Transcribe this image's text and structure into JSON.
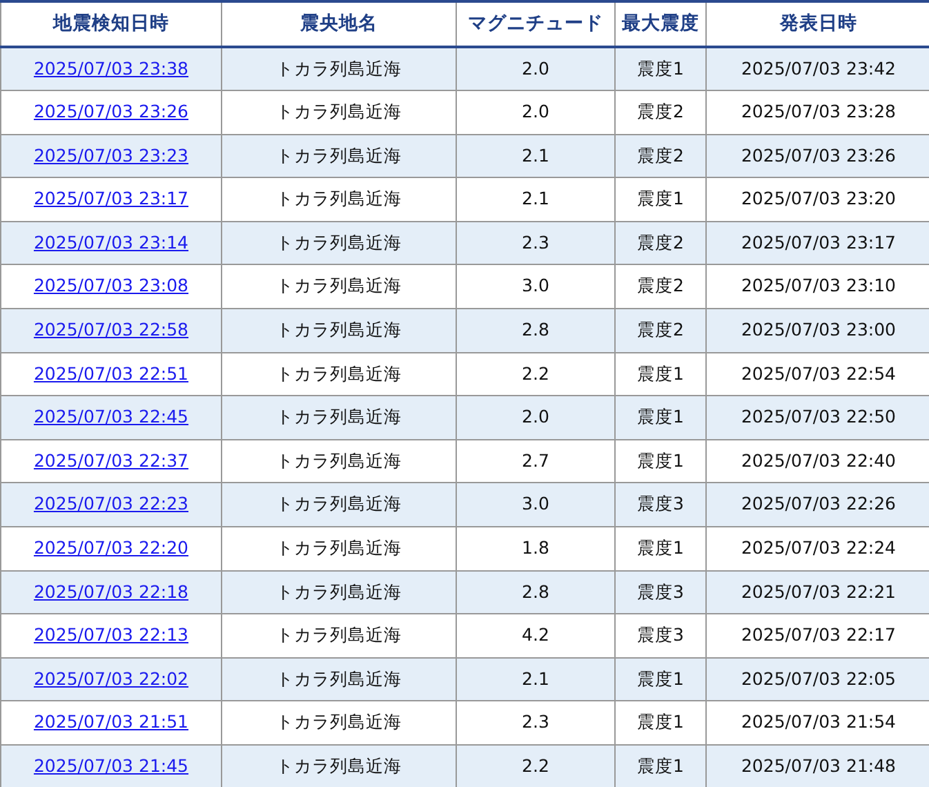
{
  "table": {
    "columns": [
      "地震検知日時",
      "震央地名",
      "マグニチュード",
      "最大震度",
      "発表日時"
    ],
    "rows": [
      {
        "detected": "2025/07/03 23:38",
        "epicenter": "トカラ列島近海",
        "magnitude": "2.0",
        "max_intensity": "震度1",
        "issued": "2025/07/03 23:42"
      },
      {
        "detected": "2025/07/03 23:26",
        "epicenter": "トカラ列島近海",
        "magnitude": "2.0",
        "max_intensity": "震度2",
        "issued": "2025/07/03 23:28"
      },
      {
        "detected": "2025/07/03 23:23",
        "epicenter": "トカラ列島近海",
        "magnitude": "2.1",
        "max_intensity": "震度2",
        "issued": "2025/07/03 23:26"
      },
      {
        "detected": "2025/07/03 23:17",
        "epicenter": "トカラ列島近海",
        "magnitude": "2.1",
        "max_intensity": "震度1",
        "issued": "2025/07/03 23:20"
      },
      {
        "detected": "2025/07/03 23:14",
        "epicenter": "トカラ列島近海",
        "magnitude": "2.3",
        "max_intensity": "震度2",
        "issued": "2025/07/03 23:17"
      },
      {
        "detected": "2025/07/03 23:08",
        "epicenter": "トカラ列島近海",
        "magnitude": "3.0",
        "max_intensity": "震度2",
        "issued": "2025/07/03 23:10"
      },
      {
        "detected": "2025/07/03 22:58",
        "epicenter": "トカラ列島近海",
        "magnitude": "2.8",
        "max_intensity": "震度2",
        "issued": "2025/07/03 23:00"
      },
      {
        "detected": "2025/07/03 22:51",
        "epicenter": "トカラ列島近海",
        "magnitude": "2.2",
        "max_intensity": "震度1",
        "issued": "2025/07/03 22:54"
      },
      {
        "detected": "2025/07/03 22:45",
        "epicenter": "トカラ列島近海",
        "magnitude": "2.0",
        "max_intensity": "震度1",
        "issued": "2025/07/03 22:50"
      },
      {
        "detected": "2025/07/03 22:37",
        "epicenter": "トカラ列島近海",
        "magnitude": "2.7",
        "max_intensity": "震度1",
        "issued": "2025/07/03 22:40"
      },
      {
        "detected": "2025/07/03 22:23",
        "epicenter": "トカラ列島近海",
        "magnitude": "3.0",
        "max_intensity": "震度3",
        "issued": "2025/07/03 22:26"
      },
      {
        "detected": "2025/07/03 22:20",
        "epicenter": "トカラ列島近海",
        "magnitude": "1.8",
        "max_intensity": "震度1",
        "issued": "2025/07/03 22:24"
      },
      {
        "detected": "2025/07/03 22:18",
        "epicenter": "トカラ列島近海",
        "magnitude": "2.8",
        "max_intensity": "震度3",
        "issued": "2025/07/03 22:21"
      },
      {
        "detected": "2025/07/03 22:13",
        "epicenter": "トカラ列島近海",
        "magnitude": "4.2",
        "max_intensity": "震度3",
        "issued": "2025/07/03 22:17"
      },
      {
        "detected": "2025/07/03 22:02",
        "epicenter": "トカラ列島近海",
        "magnitude": "2.1",
        "max_intensity": "震度1",
        "issued": "2025/07/03 22:05"
      },
      {
        "detected": "2025/07/03 21:51",
        "epicenter": "トカラ列島近海",
        "magnitude": "2.3",
        "max_intensity": "震度1",
        "issued": "2025/07/03 21:54"
      },
      {
        "detected": "2025/07/03 21:45",
        "epicenter": "トカラ列島近海",
        "magnitude": "2.2",
        "max_intensity": "震度1",
        "issued": "2025/07/03 21:48"
      }
    ]
  }
}
